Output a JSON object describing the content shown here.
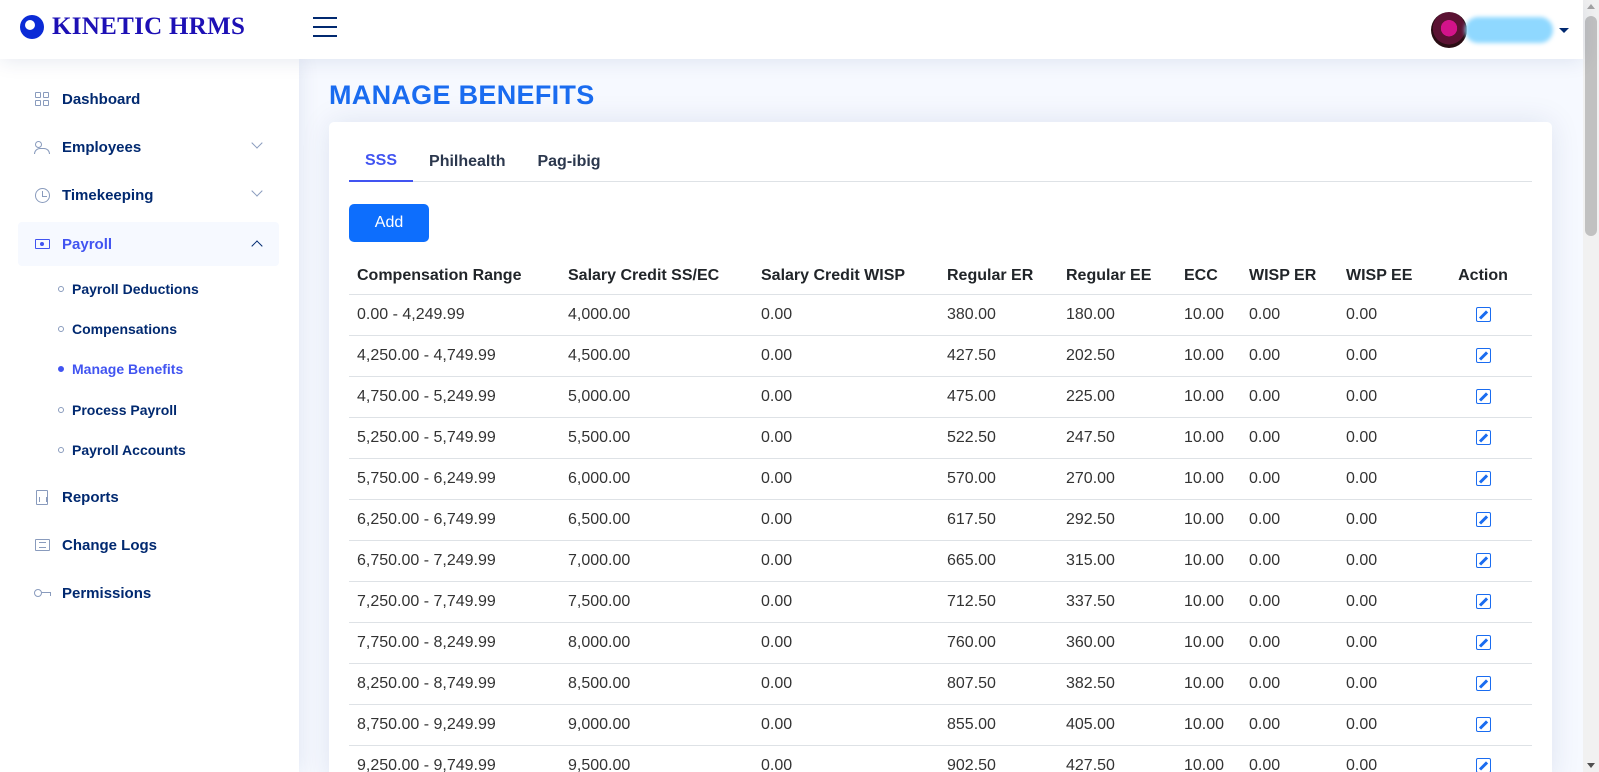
{
  "app": {
    "title": "KINETIC HRMS"
  },
  "sidebar": {
    "items": [
      {
        "label": "Dashboard",
        "icon": "grid-icon"
      },
      {
        "label": "Employees",
        "icon": "people-icon"
      },
      {
        "label": "Timekeeping",
        "icon": "clock-icon"
      },
      {
        "label": "Payroll",
        "icon": "cash-icon"
      },
      {
        "label": "Reports",
        "icon": "report-icon"
      },
      {
        "label": "Change Logs",
        "icon": "list-icon"
      },
      {
        "label": "Permissions",
        "icon": "key-icon"
      }
    ],
    "payroll_sub": [
      {
        "label": "Payroll Deductions"
      },
      {
        "label": "Compensations"
      },
      {
        "label": "Manage Benefits"
      },
      {
        "label": "Process Payroll"
      },
      {
        "label": "Payroll Accounts"
      }
    ]
  },
  "page": {
    "title": "MANAGE BENEFITS"
  },
  "tabs": [
    {
      "label": "SSS"
    },
    {
      "label": "Philhealth"
    },
    {
      "label": "Pag-ibig"
    }
  ],
  "add_label": "Add",
  "table": {
    "headers": [
      "Compensation Range",
      "Salary Credit SS/EC",
      "Salary Credit WISP",
      "Regular ER",
      "Regular EE",
      "ECC",
      "WISP ER",
      "WISP EE",
      "Action"
    ],
    "rows": [
      [
        "0.00 - 4,249.99",
        "4,000.00",
        "0.00",
        "380.00",
        "180.00",
        "10.00",
        "0.00",
        "0.00"
      ],
      [
        "4,250.00 - 4,749.99",
        "4,500.00",
        "0.00",
        "427.50",
        "202.50",
        "10.00",
        "0.00",
        "0.00"
      ],
      [
        "4,750.00 - 5,249.99",
        "5,000.00",
        "0.00",
        "475.00",
        "225.00",
        "10.00",
        "0.00",
        "0.00"
      ],
      [
        "5,250.00 - 5,749.99",
        "5,500.00",
        "0.00",
        "522.50",
        "247.50",
        "10.00",
        "0.00",
        "0.00"
      ],
      [
        "5,750.00 - 6,249.99",
        "6,000.00",
        "0.00",
        "570.00",
        "270.00",
        "10.00",
        "0.00",
        "0.00"
      ],
      [
        "6,250.00 - 6,749.99",
        "6,500.00",
        "0.00",
        "617.50",
        "292.50",
        "10.00",
        "0.00",
        "0.00"
      ],
      [
        "6,750.00 - 7,249.99",
        "7,000.00",
        "0.00",
        "665.00",
        "315.00",
        "10.00",
        "0.00",
        "0.00"
      ],
      [
        "7,250.00 - 7,749.99",
        "7,500.00",
        "0.00",
        "712.50",
        "337.50",
        "10.00",
        "0.00",
        "0.00"
      ],
      [
        "7,750.00 - 8,249.99",
        "8,000.00",
        "0.00",
        "760.00",
        "360.00",
        "10.00",
        "0.00",
        "0.00"
      ],
      [
        "8,250.00 - 8,749.99",
        "8,500.00",
        "0.00",
        "807.50",
        "382.50",
        "10.00",
        "0.00",
        "0.00"
      ],
      [
        "8,750.00 - 9,249.99",
        "9,000.00",
        "0.00",
        "855.00",
        "405.00",
        "10.00",
        "0.00",
        "0.00"
      ],
      [
        "9,250.00 - 9,749.99",
        "9,500.00",
        "0.00",
        "902.50",
        "427.50",
        "10.00",
        "0.00",
        "0.00"
      ]
    ]
  },
  "colors": {
    "accent": "#4154f1",
    "title": "#1a6cf0",
    "button": "#0d6efd",
    "nav_text": "#012970"
  }
}
